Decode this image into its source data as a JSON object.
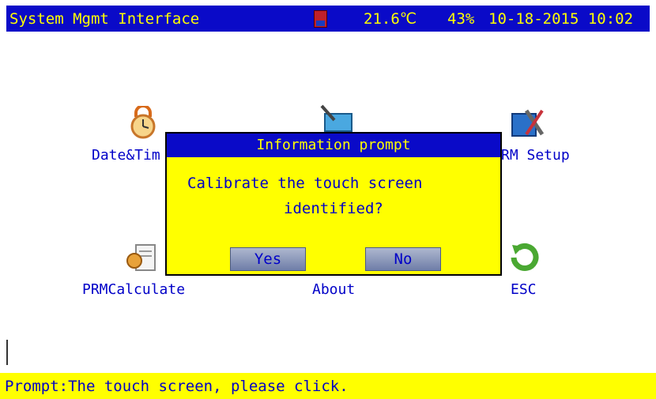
{
  "titlebar": {
    "title": "System Mgmt Interface",
    "temperature": "21.6℃",
    "humidity": "43%",
    "datetime": "10-18-2015 10:02"
  },
  "apps": {
    "date_time": "Date&Tim",
    "prm_setup": "RM Setup",
    "prm_calculate": "PRMCalculate",
    "about": "About",
    "esc": "ESC"
  },
  "dialog": {
    "title": "Information prompt",
    "message_line1": "Calibrate the touch screen",
    "message_line2": "identified?",
    "yes_label": "Yes",
    "no_label": "No"
  },
  "statusbar": {
    "prompt": "Prompt:The touch screen, please click."
  },
  "colors": {
    "bar_blue": "#0a0ac8",
    "yellow": "#ffff00",
    "text_blue": "#0000c8"
  }
}
